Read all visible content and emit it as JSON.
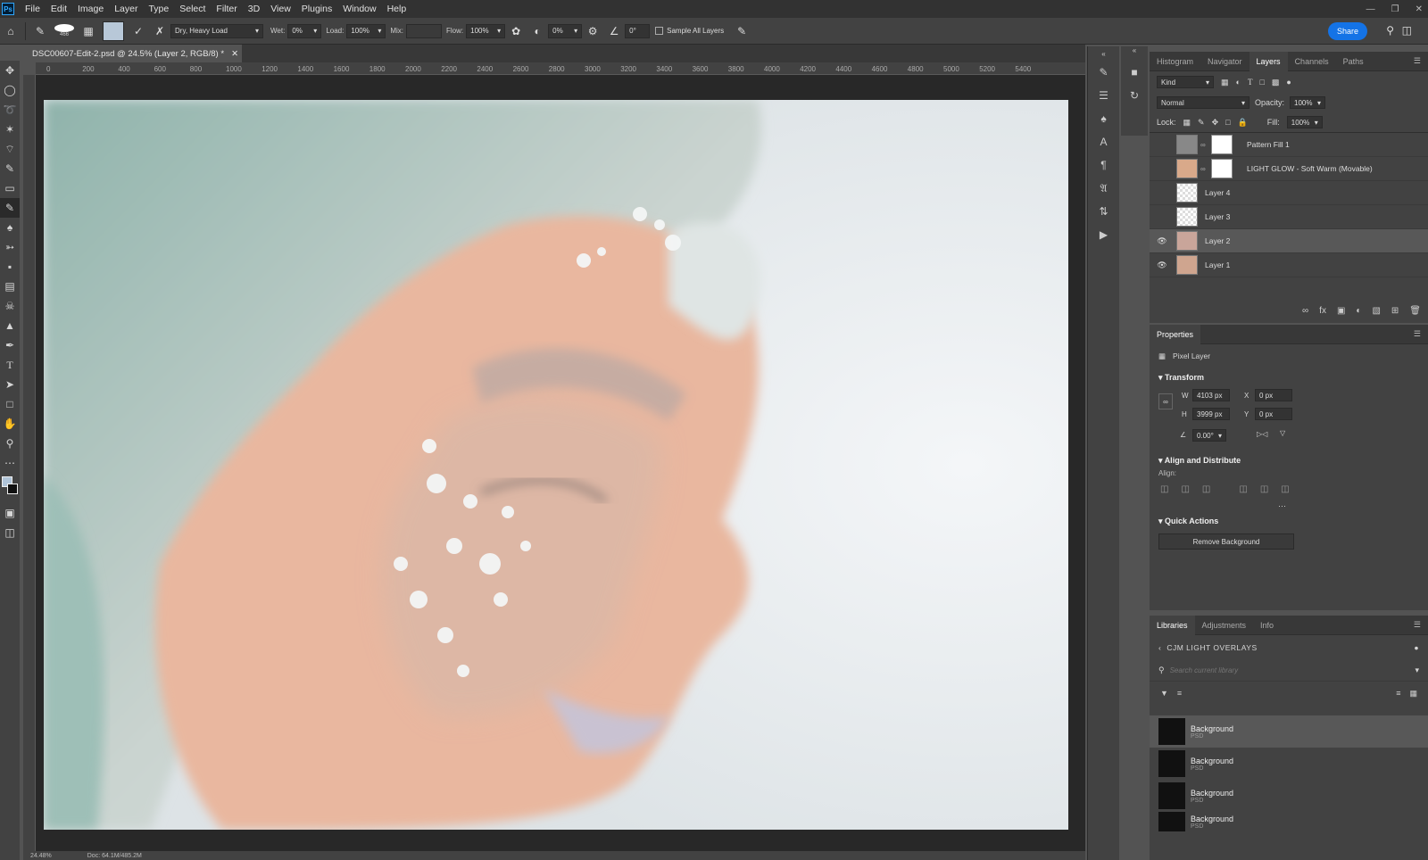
{
  "menu": {
    "items": [
      "File",
      "Edit",
      "Image",
      "Layer",
      "Type",
      "Select",
      "Filter",
      "3D",
      "View",
      "Plugins",
      "Window",
      "Help"
    ]
  },
  "options": {
    "brush_size": "466",
    "preset": "Dry, Heavy Load",
    "wet_label": "Wet:",
    "wet": "0%",
    "load_label": "Load:",
    "load": "100%",
    "mix_label": "Mix:",
    "flow_label": "Flow:",
    "flow": "100%",
    "smoothing": "0%",
    "angle": "0°",
    "sample_all": "Sample All Layers",
    "share": "Share"
  },
  "document": {
    "tab_title": "DSC00607-Edit-2.psd @ 24.5% (Layer 2, RGB/8) *",
    "zoom": "24.48%",
    "doc_info": "Doc: 64.1M/485.2M"
  },
  "ruler": {
    "ticks": [
      "0",
      "200",
      "400",
      "600",
      "800",
      "1000",
      "1200",
      "1400",
      "1600",
      "1800",
      "2000",
      "2200",
      "2400",
      "2600",
      "2800",
      "3000",
      "3200",
      "3400",
      "3600",
      "3800",
      "4000",
      "4200",
      "4400",
      "4600",
      "4800",
      "5000",
      "5200",
      "5400"
    ]
  },
  "layers_panel": {
    "tabs": [
      "Histogram",
      "Navigator",
      "Layers",
      "Channels",
      "Paths"
    ],
    "active_tab": "Layers",
    "kind": "Kind",
    "blend": "Normal",
    "opacity_label": "Opacity:",
    "opacity": "100%",
    "lock_label": "Lock:",
    "fill_label": "Fill:",
    "fill": "100%",
    "layers": [
      {
        "name": "Pattern Fill 1",
        "visible": false
      },
      {
        "name": "LIGHT GLOW - Soft Warm (Movable)",
        "visible": false
      },
      {
        "name": "Layer 4",
        "visible": false
      },
      {
        "name": "Layer 3",
        "visible": false
      },
      {
        "name": "Layer 2",
        "visible": true,
        "selected": true
      },
      {
        "name": "Layer 1",
        "visible": true
      }
    ]
  },
  "properties": {
    "title": "Properties",
    "layer_type": "Pixel Layer",
    "transform": "Transform",
    "w_label": "W",
    "w": "4103 px",
    "h_label": "H",
    "h": "3999 px",
    "x_label": "X",
    "x": "0 px",
    "y_label": "Y",
    "y": "0 px",
    "angle": "0.00°",
    "align_distribute": "Align and Distribute",
    "align_label": "Align:",
    "quick_actions": "Quick Actions",
    "remove_bg": "Remove Background"
  },
  "libraries": {
    "tabs": [
      "Libraries",
      "Adjustments",
      "Info"
    ],
    "library_name": "CJM LIGHT OVERLAYS",
    "search_placeholder": "Search current library",
    "items": [
      {
        "name": "Background",
        "type": "PSD"
      },
      {
        "name": "Background",
        "type": "PSD"
      },
      {
        "name": "Background",
        "type": "PSD"
      },
      {
        "name": "Background",
        "type": "PSD"
      }
    ]
  }
}
